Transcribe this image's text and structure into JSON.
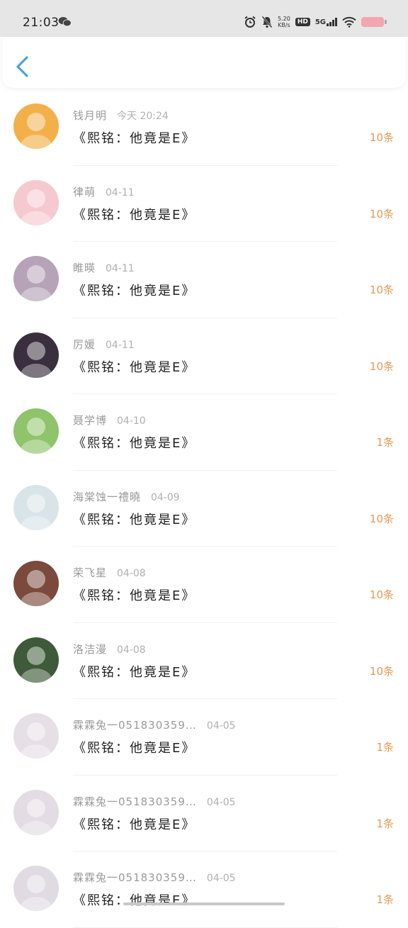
{
  "status_bar": {
    "time": "21:03",
    "net_speed_value": "5.20",
    "net_speed_unit": "KB/s",
    "hd": "HD",
    "network": "5G",
    "icons": [
      "wechat-icon",
      "alarm-icon",
      "mute-icon",
      "hd-icon",
      "signal-icon",
      "wifi-icon",
      "battery-icon"
    ],
    "battery_color": "#f2a6b0"
  },
  "header": {
    "back_icon": "chevron-left-icon",
    "accent": "#4aa3df"
  },
  "messages": [
    {
      "name": "钱月明",
      "date": "今天 20:24",
      "title": "《熙铭：他竟是E》",
      "count": "10条",
      "avatar_bg": "#f3b04a"
    },
    {
      "name": "律萌",
      "date": "04-11",
      "title": "《熙铭：他竟是E》",
      "count": "10条",
      "avatar_bg": "#f6c9d0"
    },
    {
      "name": "睢暎",
      "date": "04-11",
      "title": "《熙铭：他竟是E》",
      "count": "10条",
      "avatar_bg": "#b7a3b8"
    },
    {
      "name": "厉媛",
      "date": "04-11",
      "title": "《熙铭：他竟是E》",
      "count": "10条",
      "avatar_bg": "#3a2f3f"
    },
    {
      "name": "聂学博",
      "date": "04-10",
      "title": "《熙铭：他竟是E》",
      "count": "1条",
      "avatar_bg": "#8fc46a"
    },
    {
      "name": "海棠蚀一禮曉",
      "date": "04-09",
      "title": "《熙铭：他竟是E》",
      "count": "10条",
      "avatar_bg": "#d9e4e8"
    },
    {
      "name": "荣飞星",
      "date": "04-08",
      "title": "《熙铭：他竟是E》",
      "count": "10条",
      "avatar_bg": "#7b4a3c"
    },
    {
      "name": "洛洁漫",
      "date": "04-08",
      "title": "《熙铭：他竟是E》",
      "count": "10条",
      "avatar_bg": "#3f5a3a"
    },
    {
      "name": "霖霖兔一051830359…",
      "date": "04-05",
      "title": "《熙铭：他竟是E》",
      "count": "1条",
      "avatar_bg": "#e6dfe6"
    },
    {
      "name": "霖霖兔一051830359…",
      "date": "04-05",
      "title": "《熙铭：他竟是E》",
      "count": "1条",
      "avatar_bg": "#e3dce4"
    },
    {
      "name": "霖霖兔一051830359…",
      "date": "04-05",
      "title": "《熙铭：他竟是E》",
      "count": "1条",
      "avatar_bg": "#e0dbe3"
    }
  ]
}
